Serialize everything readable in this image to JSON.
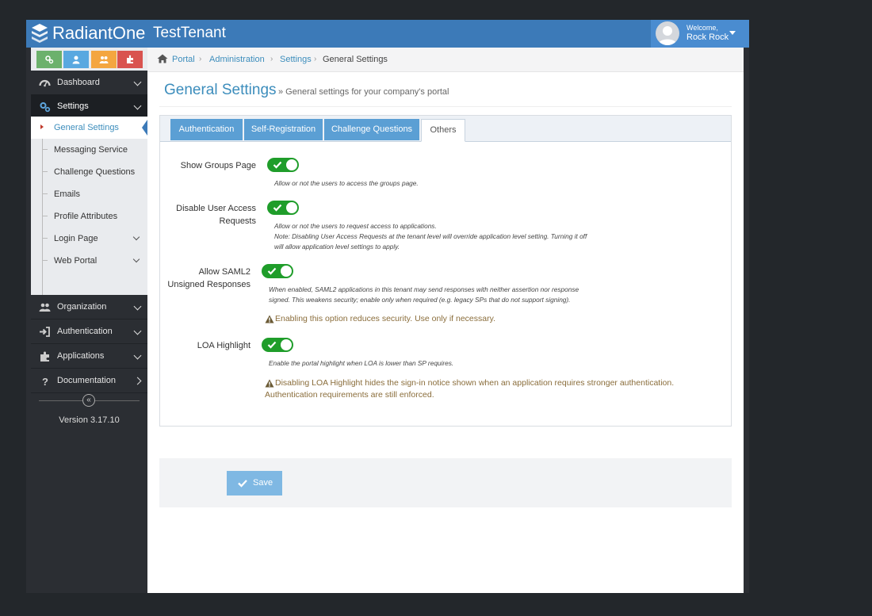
{
  "header": {
    "brand": "RadiantOne",
    "tenant": "TestTenant",
    "welcome_label": "Welcome,",
    "user_name": "Rock Rock"
  },
  "colors": {
    "header_blue": "#3c7ab8",
    "accent_link": "#3c8dbc",
    "tab_blue": "#5b9fd4",
    "toggle_green": "#1f9d2a",
    "warning_text": "#8a6d3b",
    "quick_green": "#6cb16c",
    "quick_blue": "#59a8e0",
    "quick_orange": "#f4a640",
    "quick_red": "#d9534f"
  },
  "sidebar": {
    "quick_buttons": [
      {
        "icon": "gears-icon",
        "color": "#6cb16c"
      },
      {
        "icon": "user-icon",
        "color": "#59a8e0"
      },
      {
        "icon": "users-icon",
        "color": "#f4a640"
      },
      {
        "icon": "puzzle-icon",
        "color": "#d9534f"
      }
    ],
    "items": [
      {
        "label": "Dashboard",
        "icon": "dashboard-icon"
      },
      {
        "label": "Settings",
        "icon": "gears-icon"
      },
      {
        "label": "Organization",
        "icon": "users-icon"
      },
      {
        "label": "Authentication",
        "icon": "sign-in-icon"
      },
      {
        "label": "Applications",
        "icon": "puzzle-icon"
      },
      {
        "label": "Documentation",
        "icon": "question-icon"
      }
    ],
    "settings_sub": [
      {
        "label": "General Settings"
      },
      {
        "label": "Messaging Service"
      },
      {
        "label": "Challenge Questions"
      },
      {
        "label": "Emails"
      },
      {
        "label": "Profile Attributes"
      },
      {
        "label": "Login Page"
      },
      {
        "label": "Web Portal"
      }
    ],
    "collapse_glyph": "«",
    "version": "Version 3.17.10"
  },
  "breadcrumb": {
    "items": [
      "Portal",
      "Administration",
      "Settings",
      "General Settings"
    ],
    "separator": "›"
  },
  "page": {
    "title": "General Settings",
    "subtitle": "» General settings for your company's portal"
  },
  "tabs": [
    {
      "label": "Authentication",
      "active": false
    },
    {
      "label": "Self-Registration",
      "active": false
    },
    {
      "label": "Challenge Questions",
      "active": false
    },
    {
      "label": "Others",
      "active": true
    }
  ],
  "settings": {
    "show_groups": {
      "label": "Show Groups Page",
      "enabled": true,
      "help": "Allow or not the users to access the groups page."
    },
    "disable_access": {
      "label_line1": "Disable User Access",
      "label_line2": "Requests",
      "enabled": true,
      "help_line1": "Allow or not the users to request access to applications.",
      "help_line2": "Note: Disabling User Access Requests at the tenant level will override application level setting. Turning it off",
      "help_line3": "will allow application level settings to apply."
    },
    "saml2": {
      "label_line1": "Allow SAML2",
      "label_line2": "Unsigned Responses",
      "enabled": true,
      "help_line1": "When enabled, SAML2 applications in this tenant may send responses with neither assertion nor response",
      "help_line2": "signed. This weakens security; enable only when required (e.g. legacy SPs that do not support signing).",
      "warning": "Enabling this option reduces security. Use only if necessary."
    },
    "loa": {
      "label": "LOA Highlight",
      "enabled": true,
      "help": "Enable the portal highlight when LOA is lower than SP requires.",
      "warning_line1": "Disabling LOA Highlight hides the sign-in notice shown when an application requires stronger authentication.",
      "warning_line2": "Authentication requirements are still enforced."
    }
  },
  "actions": {
    "save_label": "Save"
  }
}
